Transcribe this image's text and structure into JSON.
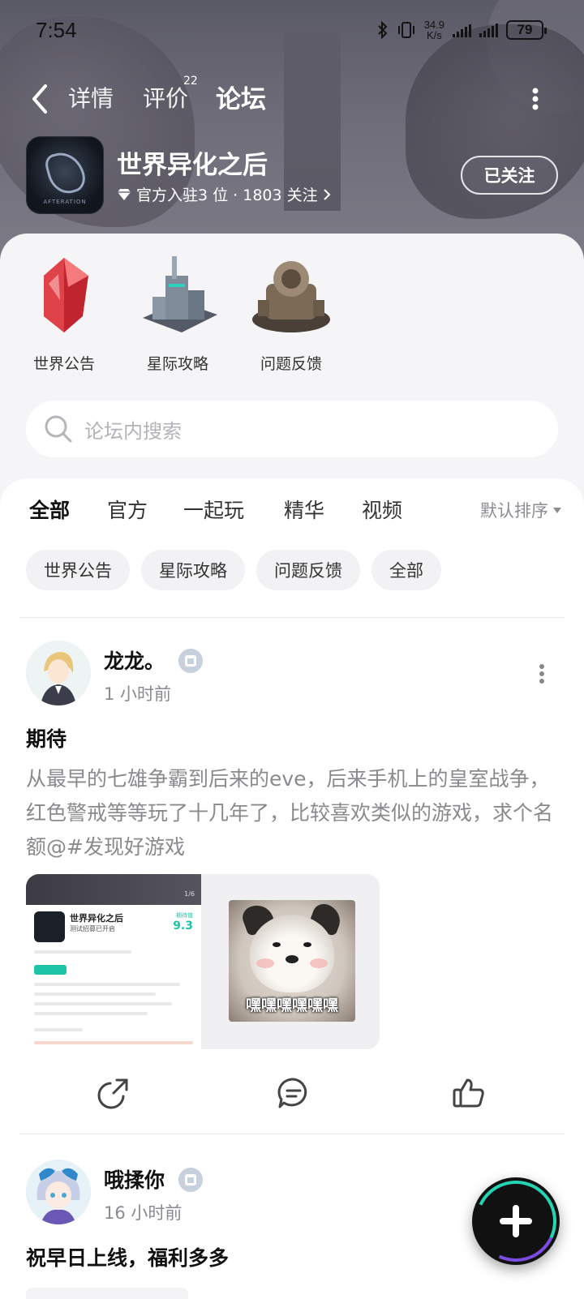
{
  "status_bar": {
    "time": "7:54",
    "net_speed_value": "34.9",
    "net_speed_unit": "K/s",
    "battery": "79"
  },
  "nav": {
    "tabs": [
      {
        "label": "详情"
      },
      {
        "label": "评价",
        "badge": "22"
      },
      {
        "label": "论坛"
      }
    ],
    "active_tab": "论坛"
  },
  "game": {
    "title": "世界异化之后",
    "icon_caption": "AFTERATION",
    "meta": "官方入驻3 位 · 1803 关注",
    "follow_label": "已关注"
  },
  "shortcuts": [
    {
      "label": "世界公告",
      "icon": "red-crystal-icon"
    },
    {
      "label": "星际攻略",
      "icon": "sci-fi-tower-icon"
    },
    {
      "label": "问题反馈",
      "icon": "mech-base-icon"
    }
  ],
  "search": {
    "placeholder": "论坛内搜索"
  },
  "filter_tabs": [
    "全部",
    "官方",
    "一起玩",
    "精华",
    "视频"
  ],
  "active_filter": "全部",
  "sort_label": "默认排序",
  "chips": [
    "世界公告",
    "星际攻略",
    "问题反馈",
    "全部"
  ],
  "posts": [
    {
      "author": "龙龙。",
      "time": "1 小时前",
      "title": "期待",
      "body": "从最早的七雄争霸到后来的eve，后来手机上的皇室战争，红色警戒等等玩了十几年了，比较喜欢类似的游戏，求个名额@#发现好游戏",
      "screenshot": {
        "title": "世界异化之后",
        "status": "测试招募已开启",
        "score_label": "期待值",
        "score": "9.3",
        "page": "1/6"
      },
      "meme_caption": "嘿嘿嘿嘿嘿嘿"
    },
    {
      "author": "哦揉你",
      "time": "16 小时前",
      "title": "祝早日上线，福利多多"
    }
  ],
  "actions": {
    "share_icon": "share-icon",
    "comment_icon": "comment-icon",
    "like_icon": "thumbs-up-icon"
  },
  "fab": {
    "icon": "plus-icon"
  },
  "colors": {
    "accent": "#1ed4b4",
    "fab_ring_purple": "#7a4de0"
  }
}
